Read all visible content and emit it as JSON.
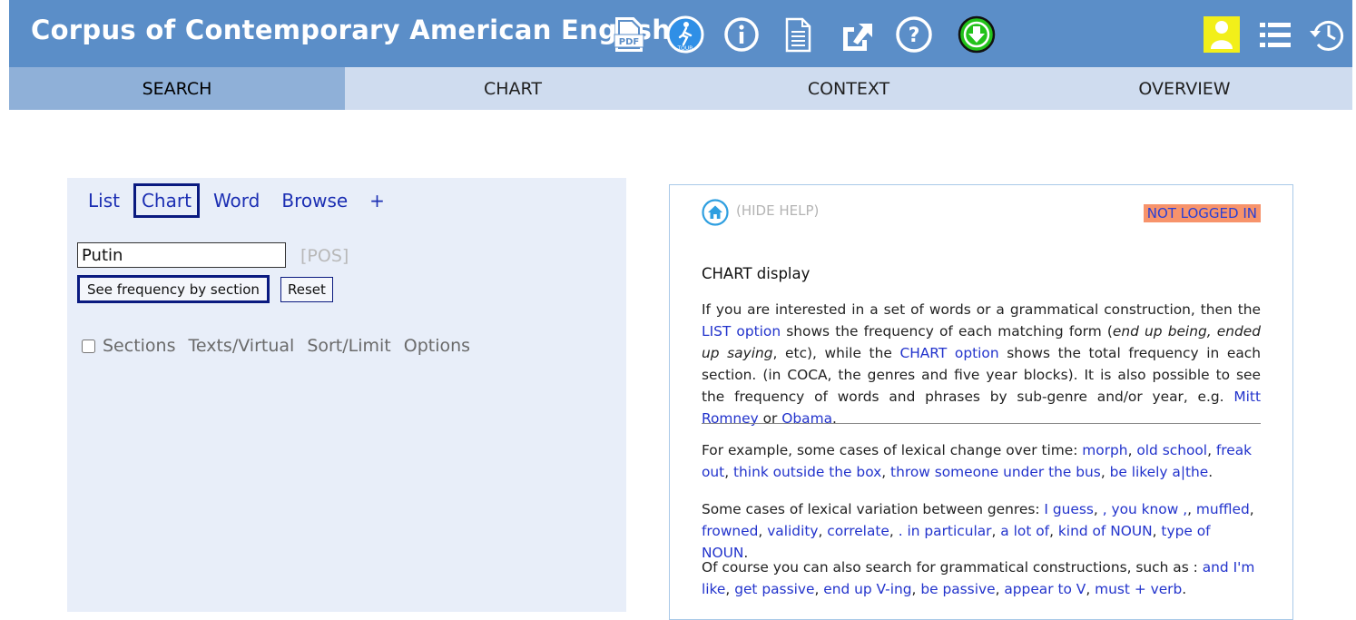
{
  "header": {
    "title": "Corpus of Contemporary American English",
    "icons": [
      "pdf-icon",
      "tour-icon",
      "info-icon",
      "document-icon",
      "external-link-icon",
      "help-icon",
      "download-icon",
      "user-icon",
      "list-icon",
      "history-icon"
    ],
    "pdf_label": "PDF",
    "tour_label": "TOUR",
    "colors": {
      "bar": "#5b8ec8",
      "download": "#22c21a",
      "user_bg": "#f2ef1a"
    }
  },
  "nav": {
    "tabs": [
      {
        "label": "SEARCH",
        "active": true
      },
      {
        "label": "CHART",
        "active": false
      },
      {
        "label": "CONTEXT",
        "active": false
      },
      {
        "label": "OVERVIEW",
        "active": false
      }
    ]
  },
  "search": {
    "modes": [
      "List",
      "Chart",
      "Word",
      "Browse",
      "+"
    ],
    "active_mode": "Chart",
    "input_value": "Putin",
    "pos_label": "[POS]",
    "submit_label": "See frequency by section",
    "reset_label": "Reset",
    "sections_checked": false,
    "options": [
      "Sections",
      "Texts/Virtual",
      "Sort/Limit",
      "Options"
    ]
  },
  "help": {
    "hide_label": "(HIDE HELP)",
    "login_status": "NOT LOGGED IN",
    "heading": "CHART display",
    "p1": {
      "t1": "If you are interested in a set of words or a grammatical construction, then the ",
      "link1": "LIST option",
      "t2": " shows the frequency of each matching form (",
      "em": "end up being, ended up saying",
      "t3": ", etc), while the ",
      "link2": "CHART option",
      "t4": " shows the total frequency in each section. (in COCA, the genres and five year blocks). It is also possible to see the frequency of words and phrases by sub-genre and/or year, e.g. ",
      "link3": "Mitt Romney",
      "t5": " or ",
      "link4": "Obama",
      "t6": "."
    },
    "p2": {
      "intro": "For example, some cases of lexical change over time: ",
      "links": [
        "morph",
        "old school",
        "freak out",
        "think outside the box",
        "throw someone under the bus",
        "be likely a|the"
      ]
    },
    "p3": {
      "intro": "Some cases of lexical variation between genres: ",
      "links": [
        "I guess",
        ", you know ,",
        "muffled",
        "frowned",
        "validity",
        "correlate",
        ". in particular",
        "a lot of",
        "kind of NOUN",
        "type of NOUN"
      ]
    },
    "p4": {
      "intro": "Of course you can also search for grammatical constructions, such as : ",
      "links": [
        "and I'm like",
        "get passive",
        "end up V-ing",
        "be passive",
        "appear to V",
        "must + verb"
      ]
    }
  }
}
